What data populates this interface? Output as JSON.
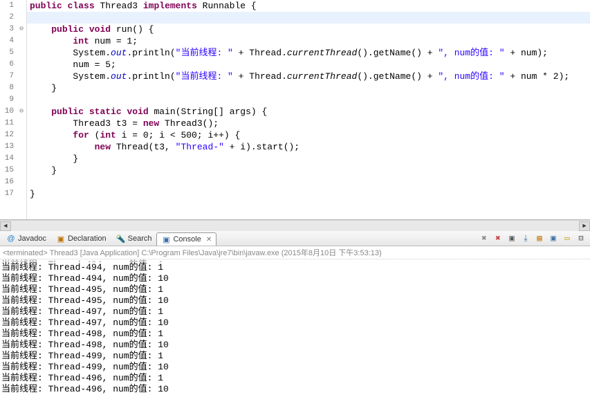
{
  "code": {
    "lines": [
      {
        "n": 1,
        "fold": "",
        "hl": false,
        "tokens": [
          {
            "t": "public",
            "c": "kw"
          },
          {
            "t": " "
          },
          {
            "t": "class",
            "c": "kw"
          },
          {
            "t": " Thread3 "
          },
          {
            "t": "implements",
            "c": "kw"
          },
          {
            "t": " Runnable {"
          }
        ]
      },
      {
        "n": 2,
        "fold": "",
        "hl": true,
        "tokens": []
      },
      {
        "n": 3,
        "fold": "⊖",
        "hl": false,
        "tokens": [
          {
            "t": "    "
          },
          {
            "t": "public",
            "c": "kw"
          },
          {
            "t": " "
          },
          {
            "t": "void",
            "c": "kw"
          },
          {
            "t": " run() {"
          }
        ]
      },
      {
        "n": 4,
        "fold": "",
        "hl": false,
        "tokens": [
          {
            "t": "        "
          },
          {
            "t": "int",
            "c": "kw"
          },
          {
            "t": " num = 1;"
          }
        ]
      },
      {
        "n": 5,
        "fold": "",
        "hl": false,
        "tokens": [
          {
            "t": "        System."
          },
          {
            "t": "out",
            "c": "fld"
          },
          {
            "t": ".println("
          },
          {
            "t": "\"当前线程: \"",
            "c": "str"
          },
          {
            "t": " + Thread."
          },
          {
            "t": "currentThread",
            "c": "mth"
          },
          {
            "t": "().getName() + "
          },
          {
            "t": "\", num的值: \"",
            "c": "str"
          },
          {
            "t": " + num);"
          }
        ]
      },
      {
        "n": 6,
        "fold": "",
        "hl": false,
        "tokens": [
          {
            "t": "        num = 5;"
          }
        ]
      },
      {
        "n": 7,
        "fold": "",
        "hl": false,
        "tokens": [
          {
            "t": "        System."
          },
          {
            "t": "out",
            "c": "fld"
          },
          {
            "t": ".println("
          },
          {
            "t": "\"当前线程: \"",
            "c": "str"
          },
          {
            "t": " + Thread."
          },
          {
            "t": "currentThread",
            "c": "mth"
          },
          {
            "t": "().getName() + "
          },
          {
            "t": "\", num的值: \"",
            "c": "str"
          },
          {
            "t": " + num * 2);"
          }
        ]
      },
      {
        "n": 8,
        "fold": "",
        "hl": false,
        "tokens": [
          {
            "t": "    }"
          }
        ]
      },
      {
        "n": 9,
        "fold": "",
        "hl": false,
        "tokens": []
      },
      {
        "n": 10,
        "fold": "⊖",
        "hl": false,
        "tokens": [
          {
            "t": "    "
          },
          {
            "t": "public",
            "c": "kw"
          },
          {
            "t": " "
          },
          {
            "t": "static",
            "c": "kw"
          },
          {
            "t": " "
          },
          {
            "t": "void",
            "c": "kw"
          },
          {
            "t": " main(String[] args) {"
          }
        ]
      },
      {
        "n": 11,
        "fold": "",
        "hl": false,
        "tokens": [
          {
            "t": "        Thread3 t3 = "
          },
          {
            "t": "new",
            "c": "kw"
          },
          {
            "t": " Thread3();"
          }
        ]
      },
      {
        "n": 12,
        "fold": "",
        "hl": false,
        "tokens": [
          {
            "t": "        "
          },
          {
            "t": "for",
            "c": "kw"
          },
          {
            "t": " ("
          },
          {
            "t": "int",
            "c": "kw"
          },
          {
            "t": " i = 0; i < 500; i++) {"
          }
        ]
      },
      {
        "n": 13,
        "fold": "",
        "hl": false,
        "tokens": [
          {
            "t": "            "
          },
          {
            "t": "new",
            "c": "kw"
          },
          {
            "t": " Thread(t3, "
          },
          {
            "t": "\"Thread-\"",
            "c": "str"
          },
          {
            "t": " + i).start();"
          }
        ]
      },
      {
        "n": 14,
        "fold": "",
        "hl": false,
        "tokens": [
          {
            "t": "        }"
          }
        ]
      },
      {
        "n": 15,
        "fold": "",
        "hl": false,
        "tokens": [
          {
            "t": "    }"
          }
        ]
      },
      {
        "n": 16,
        "fold": "",
        "hl": false,
        "tokens": []
      },
      {
        "n": 17,
        "fold": "",
        "hl": false,
        "tokens": [
          {
            "t": "}"
          }
        ]
      }
    ]
  },
  "tabs": [
    {
      "id": "javadoc",
      "label": "Javadoc",
      "icon": "@",
      "iconColor": "#1e7fce",
      "active": false
    },
    {
      "id": "declaration",
      "label": "Declaration",
      "icon": "▣",
      "iconColor": "#c07000",
      "active": false
    },
    {
      "id": "search",
      "label": "Search",
      "icon": "🔦",
      "iconColor": "#d0a000",
      "active": false
    },
    {
      "id": "console",
      "label": "Console",
      "icon": "▣",
      "iconColor": "#3a6ea5",
      "active": true
    }
  ],
  "toolbar_icons": [
    "✖",
    "✖",
    "▣",
    "⤓",
    "▤",
    "▣",
    "▭",
    "⊟"
  ],
  "toolbar_colors": [
    "#888",
    "#c84040",
    "#555",
    "#3a6ea5",
    "#c07000",
    "#3a6ea5",
    "#c0a000",
    "#555"
  ],
  "termination_line": "<terminated> Thread3 [Java Application] C:\\Program Files\\Java\\jre7\\bin\\javaw.exe (2015年8月10日 下午3:53:13)",
  "console_output": [
    "当前线程: Thread-494, num的值: 1",
    "当前线程: Thread-494, num的值: 10",
    "当前线程: Thread-495, num的值: 1",
    "当前线程: Thread-495, num的值: 10",
    "当前线程: Thread-497, num的值: 1",
    "当前线程: Thread-497, num的值: 10",
    "当前线程: Thread-498, num的值: 1",
    "当前线程: Thread-498, num的值: 10",
    "当前线程: Thread-499, num的值: 1",
    "当前线程: Thread-499, num的值: 10",
    "当前线程: Thread-496, num的值: 1",
    "当前线程: Thread-496, num的值: 10"
  ]
}
